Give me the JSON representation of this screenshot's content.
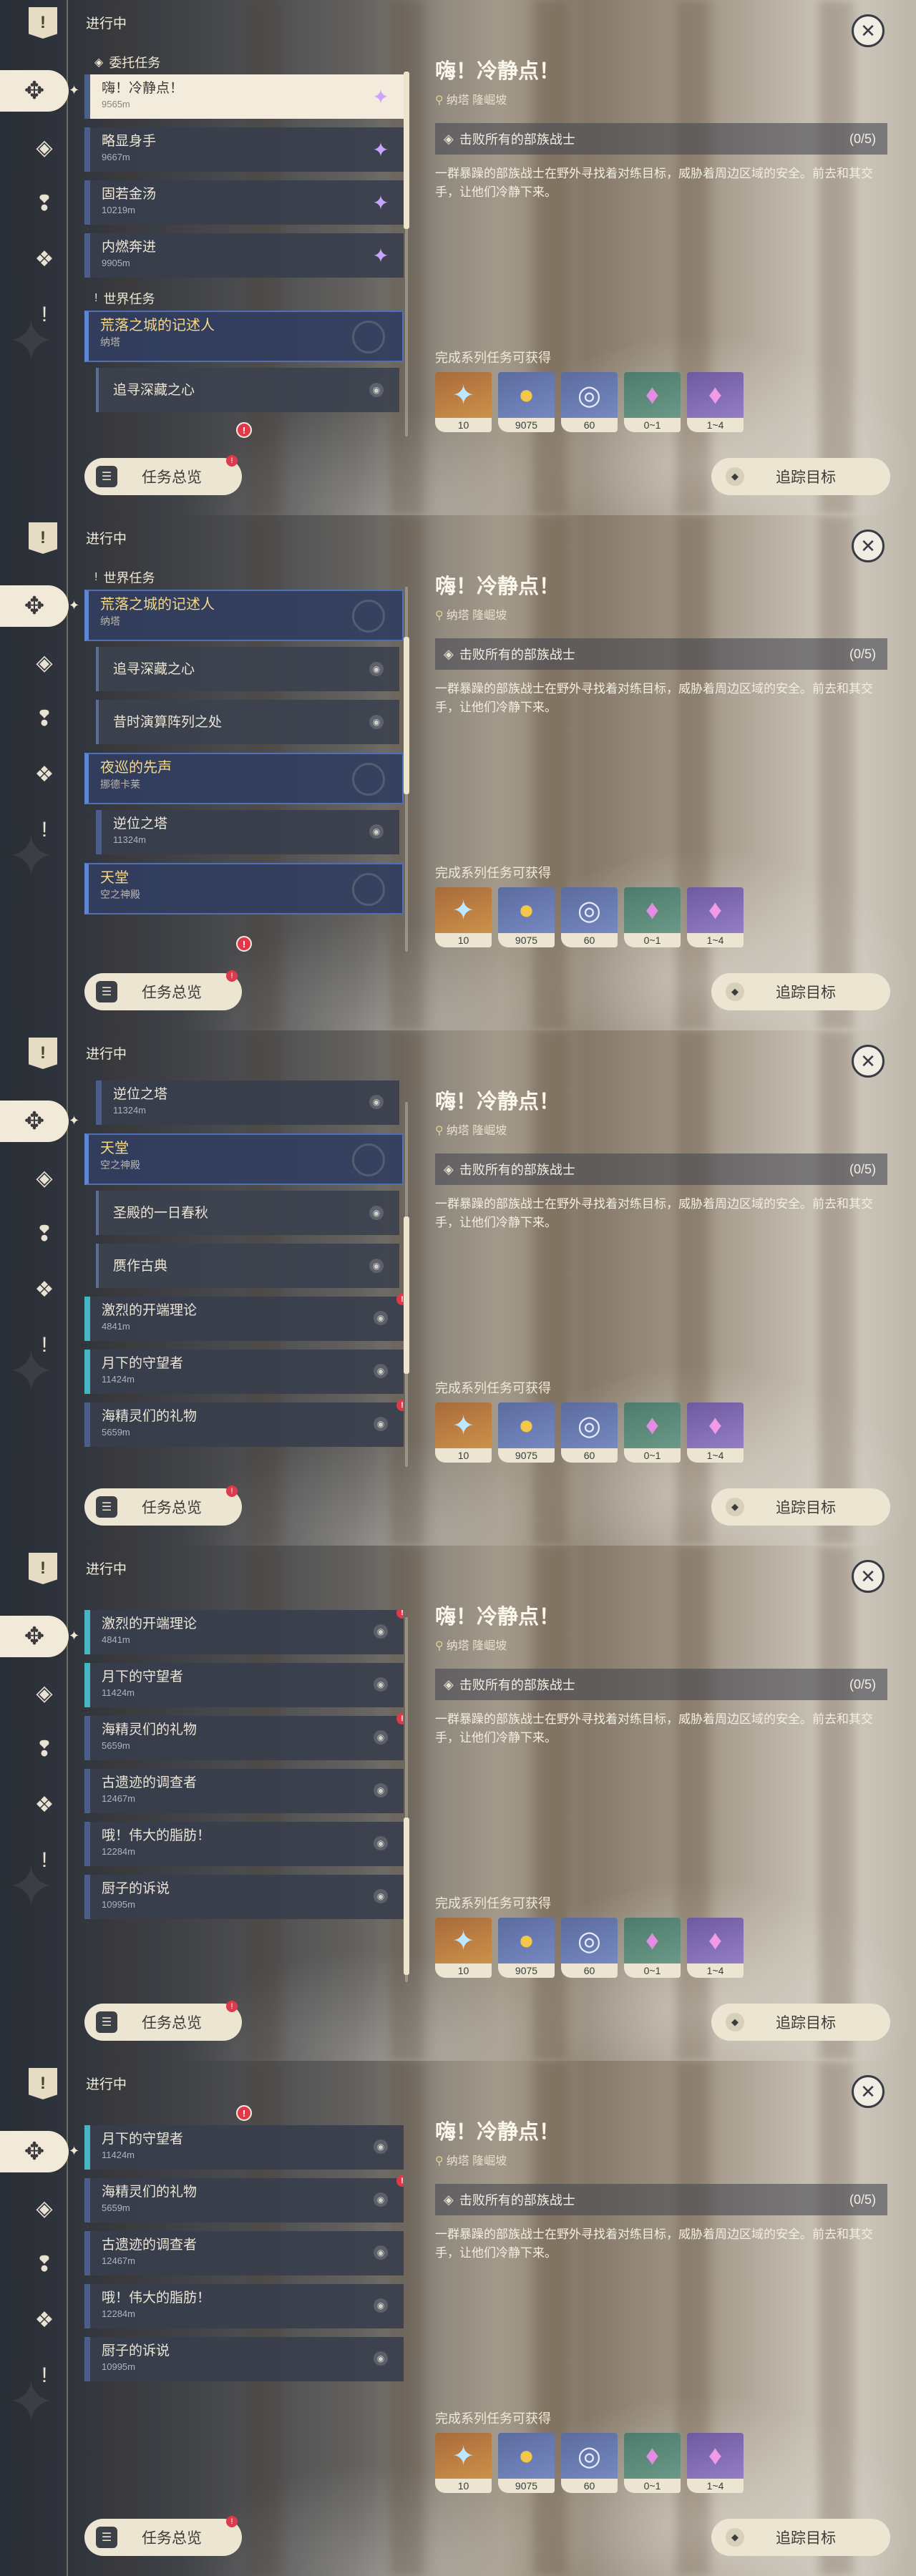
{
  "header": {
    "label": "进行中",
    "close_icon": "close-icon"
  },
  "categories": {
    "commission": "委托任务",
    "world": "世界任务"
  },
  "commissions": [
    {
      "name": "嗨！冷静点！",
      "distance": "9565m",
      "selected": true
    },
    {
      "name": "略显身手",
      "distance": "9667m"
    },
    {
      "name": "固若金汤",
      "distance": "10219m"
    },
    {
      "name": "内燃奔进",
      "distance": "9905m"
    }
  ],
  "groups": [
    {
      "name": "荒落之城的记述人",
      "region": "纳塔"
    },
    {
      "name": "夜巡的先声",
      "region": "挪德卡莱"
    },
    {
      "name": "天堂",
      "region": "空之神殿"
    }
  ],
  "subquests": {
    "a": "追寻深藏之心",
    "b": "昔时演算阵列之处",
    "c": "逆位之塔",
    "c_dist": "11324m",
    "d": "圣殿的一日春秋",
    "e": "赝作古典"
  },
  "others": [
    {
      "name": "激烈的开端理论",
      "distance": "4841m"
    },
    {
      "name": "月下的守望者",
      "distance": "11424m"
    },
    {
      "name": "海精灵们的礼物",
      "distance": "5659m"
    },
    {
      "name": "古遗迹的调查者",
      "distance": "12467m"
    },
    {
      "name": "哦！伟大的脂肪！",
      "distance": "12284m"
    },
    {
      "name": "厨子的诉说",
      "distance": "10995m"
    }
  ],
  "buttons": {
    "overview": "任务总览",
    "track": "追踪目标"
  },
  "detail": {
    "title": "嗨！冷静点！",
    "location": "纳塔 隆崛坡",
    "objective": "击败所有的部族战士",
    "progress": "(0/5)",
    "description": "一群暴躁的部族战士在野外寻找着对练目标，威胁着周边区域的安全。前去和其交手，让他们冷静下来。",
    "rewards_label": "完成系列任务可获得",
    "rewards": [
      {
        "icon": "sparkle-icon",
        "qty": "10",
        "color": "orange"
      },
      {
        "icon": "mora-icon",
        "qty": "9075",
        "color": "blue"
      },
      {
        "icon": "exp-ring-icon",
        "qty": "60",
        "color": "blue"
      },
      {
        "icon": "crystal-green-icon",
        "qty": "0~1",
        "color": "green"
      },
      {
        "icon": "crystal-purple-icon",
        "qty": "1~4",
        "color": "purple"
      }
    ]
  }
}
